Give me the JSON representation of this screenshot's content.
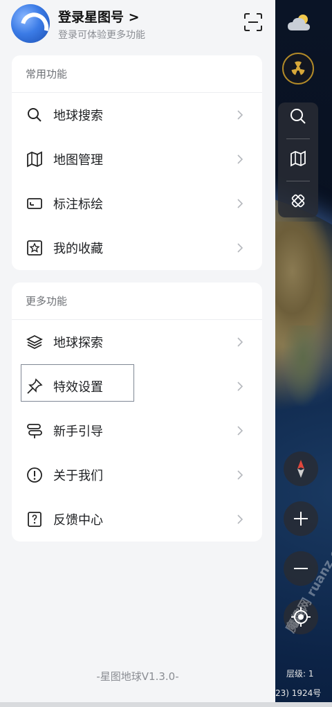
{
  "header": {
    "login_title": "登录星图号 >",
    "login_subtitle": "登录可体验更多功能",
    "logo_icon": "app-logo",
    "scan_icon": "scan-icon"
  },
  "common_section": {
    "title": "常用功能",
    "items": [
      {
        "label": "地球搜索",
        "icon": "search-icon"
      },
      {
        "label": "地图管理",
        "icon": "map-icon"
      },
      {
        "label": "标注标绘",
        "icon": "annotate-icon"
      },
      {
        "label": "我的收藏",
        "icon": "favorites-icon"
      }
    ]
  },
  "more_section": {
    "title": "更多功能",
    "items": [
      {
        "label": "地球探索",
        "icon": "layers-icon"
      },
      {
        "label": "特效设置",
        "icon": "pin-icon"
      },
      {
        "label": "新手引导",
        "icon": "signpost-icon"
      },
      {
        "label": "关于我们",
        "icon": "info-icon"
      },
      {
        "label": "反馈中心",
        "icon": "feedback-icon"
      }
    ]
  },
  "footer": {
    "version": "-星图地球V1.3.0-"
  },
  "map": {
    "level_text": "层级: 1",
    "icp_text": "23) 1924号",
    "watermark": "魔趣网 ruanz.com"
  },
  "colors": {
    "drawer_bg": "#f4f5f7",
    "card_bg": "#ffffff",
    "accent_gold": "#b28a28"
  }
}
